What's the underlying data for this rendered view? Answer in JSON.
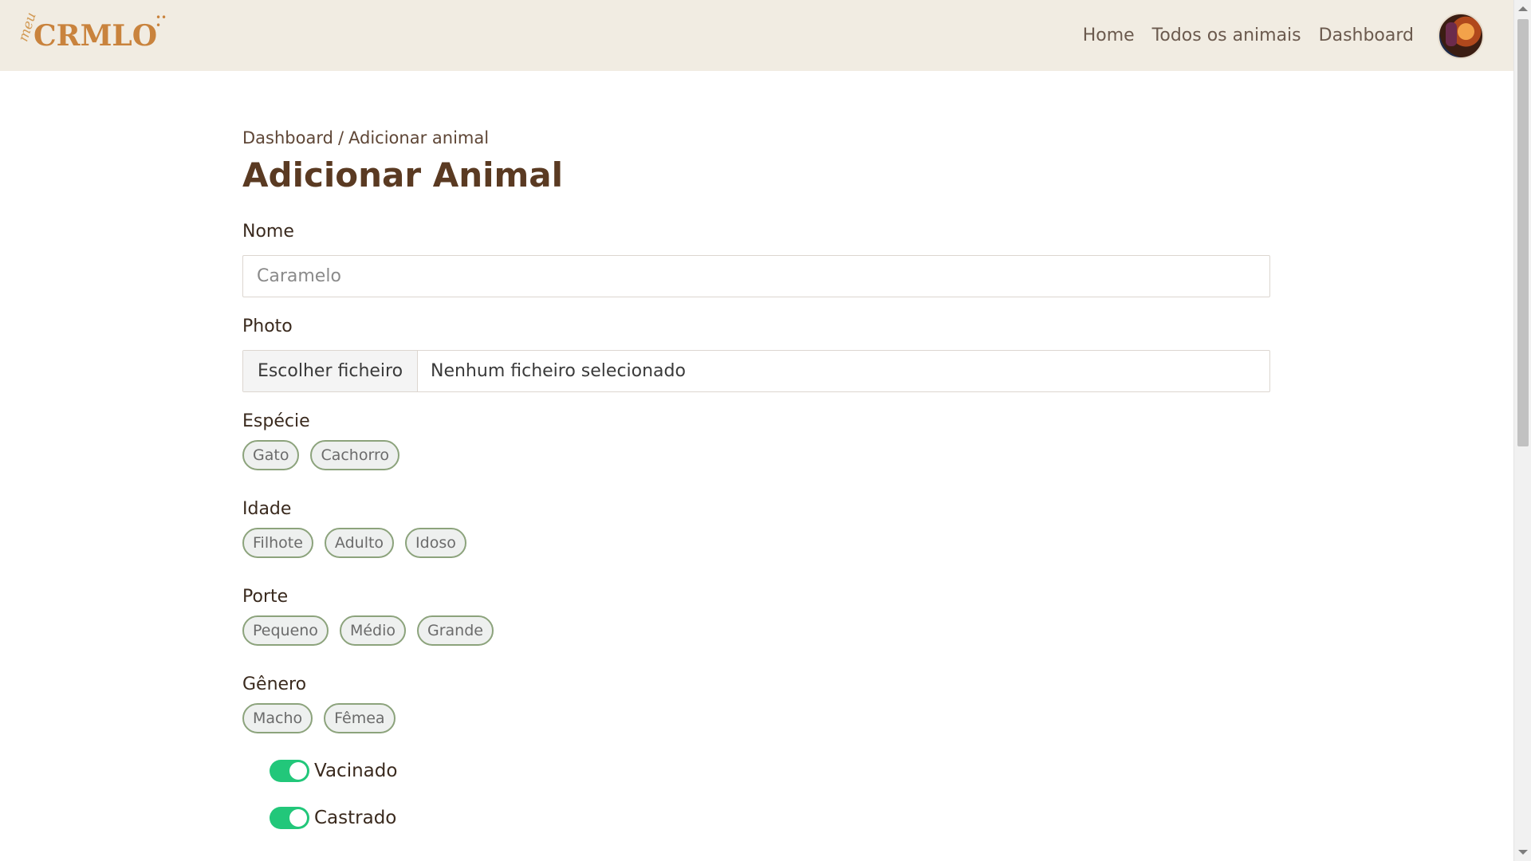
{
  "navbar": {
    "logo_prefix": "meu",
    "logo_text": "CRMLO",
    "links": [
      "Home",
      "Todos os animais",
      "Dashboard"
    ]
  },
  "breadcrumb": {
    "parent": "Dashboard",
    "separator": "/",
    "current": "Adicionar animal"
  },
  "page_title": "Adicionar Animal",
  "form": {
    "nome": {
      "label": "Nome",
      "placeholder": "Caramelo",
      "value": ""
    },
    "photo": {
      "label": "Photo",
      "button_label": "Escolher ficheiro",
      "status": "Nenhum ficheiro selecionado"
    },
    "especie": {
      "label": "Espécie",
      "options": [
        "Gato",
        "Cachorro"
      ]
    },
    "idade": {
      "label": "Idade",
      "options": [
        "Filhote",
        "Adulto",
        "Idoso"
      ]
    },
    "porte": {
      "label": "Porte",
      "options": [
        "Pequeno",
        "Médio",
        "Grande"
      ]
    },
    "genero": {
      "label": "Gênero",
      "options": [
        "Macho",
        "Fêmea"
      ]
    },
    "toggles": [
      {
        "label": "Vacinado",
        "checked": true
      },
      {
        "label": "Castrado",
        "checked": true
      }
    ]
  },
  "colors": {
    "navbar_bg": "#f1ece2",
    "brand": "#c9833d",
    "title": "#5a3a22",
    "chip_border": "#8ca37c",
    "toggle_on": "#22c77a"
  }
}
